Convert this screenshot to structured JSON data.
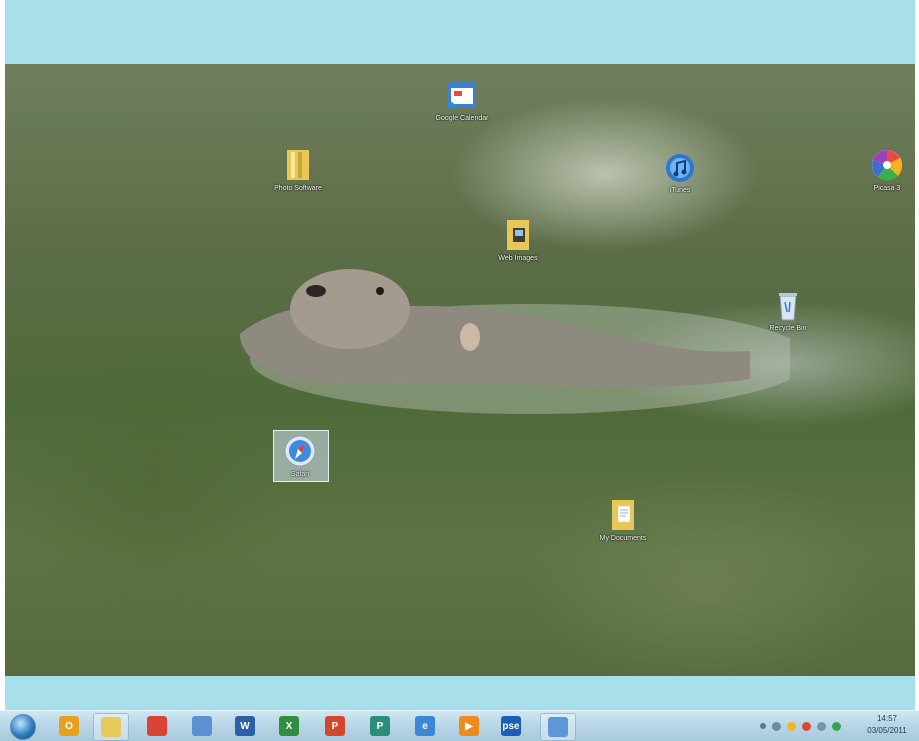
{
  "desktop_icons": [
    {
      "label": "Google Calendar",
      "icon": "calendar-app-icon"
    },
    {
      "label": "Photo Software",
      "icon": "folder-icon"
    },
    {
      "label": "iTunes",
      "icon": "itunes-icon"
    },
    {
      "label": "Picasa 3",
      "icon": "picasa-icon"
    },
    {
      "label": "Web Images",
      "icon": "folder-icon"
    },
    {
      "label": "Recycle Bin",
      "icon": "recycle-bin-icon"
    },
    {
      "label": "Safari",
      "icon": "safari-icon"
    },
    {
      "label": "My Documents",
      "icon": "folder-icon"
    }
  ],
  "taskbar": {
    "buttons": [
      {
        "name": "outlook",
        "text": "O",
        "color": "#e6a21f"
      },
      {
        "name": "explorer",
        "text": "",
        "color": "#e7c95c"
      },
      {
        "name": "chrome",
        "text": "",
        "color": "#d94435"
      },
      {
        "name": "network",
        "text": "",
        "color": "#5d8fd3"
      },
      {
        "name": "word",
        "text": "W",
        "color": "#2c5fa8"
      },
      {
        "name": "excel",
        "text": "X",
        "color": "#2f8f3e"
      },
      {
        "name": "powerpoint",
        "text": "P",
        "color": "#d1492a"
      },
      {
        "name": "publisher",
        "text": "P",
        "color": "#2a8e7a"
      },
      {
        "name": "ie",
        "text": "e",
        "color": "#3c86d6"
      },
      {
        "name": "media-player",
        "text": "▶",
        "color": "#f08a1c"
      },
      {
        "name": "pse",
        "text": "pse",
        "color": "#1b5fb4"
      },
      {
        "name": "remote-desktop",
        "text": "",
        "color": "#5e97d8"
      }
    ],
    "clock_time": "14:57",
    "clock_date": "03/05/2011"
  }
}
